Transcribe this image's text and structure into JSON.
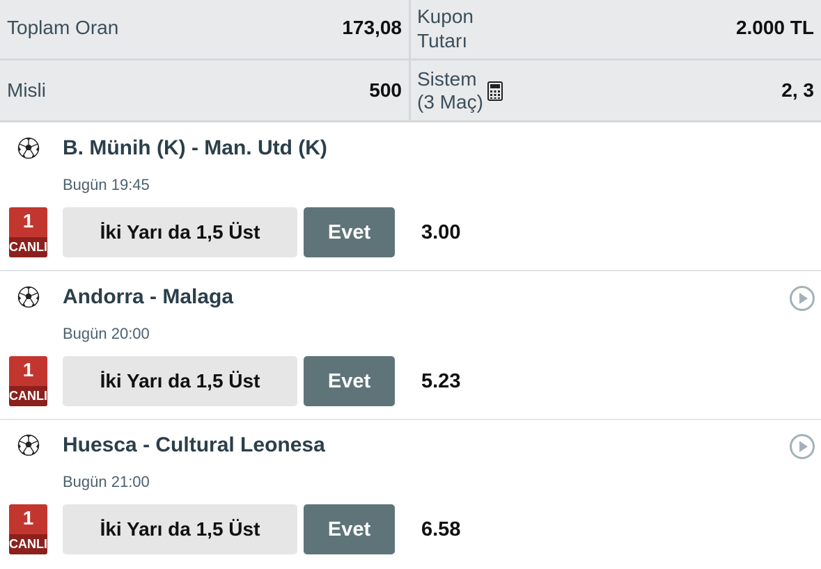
{
  "summary": {
    "total_odds_label": "Toplam Oran",
    "total_odds_value": "173,08",
    "coupon_amount_label_line1": "Kupon",
    "coupon_amount_label_line2": "Tutarı",
    "coupon_amount_value": "2.000 TL",
    "multiplier_label": "Misli",
    "multiplier_value": "500",
    "system_label_line1": "Sistem",
    "system_label_line2": "(3 Maç)",
    "system_value": "2, 3",
    "calculator_icon": "calculator-icon"
  },
  "matches": [
    {
      "title": "B. Münih (K) - Man. Utd (K)",
      "time": "Bugün 19:45",
      "live_number": "1",
      "live_label": "CANLI",
      "market": "İki Yarı da 1,5 Üst",
      "pick": "Evet",
      "odd": "3.00",
      "has_play_icon": false
    },
    {
      "title": "Andorra - Malaga",
      "time": "Bugün 20:00",
      "live_number": "1",
      "live_label": "CANLI",
      "market": "İki Yarı da 1,5 Üst",
      "pick": "Evet",
      "odd": "5.23",
      "has_play_icon": true
    },
    {
      "title": "Huesca - Cultural Leonesa",
      "time": "Bugün 21:00",
      "live_number": "1",
      "live_label": "CANLI",
      "market": "İki Yarı da 1,5 Üst",
      "pick": "Evet",
      "odd": "6.58",
      "has_play_icon": true
    }
  ],
  "colors": {
    "summary_bg": "#e8eaec",
    "live_red": "#c33630",
    "live_dark_red": "#8c201c",
    "pick_bg": "#5e7479",
    "market_bg": "#e6e6e6",
    "title_color": "#2b3f4a"
  }
}
